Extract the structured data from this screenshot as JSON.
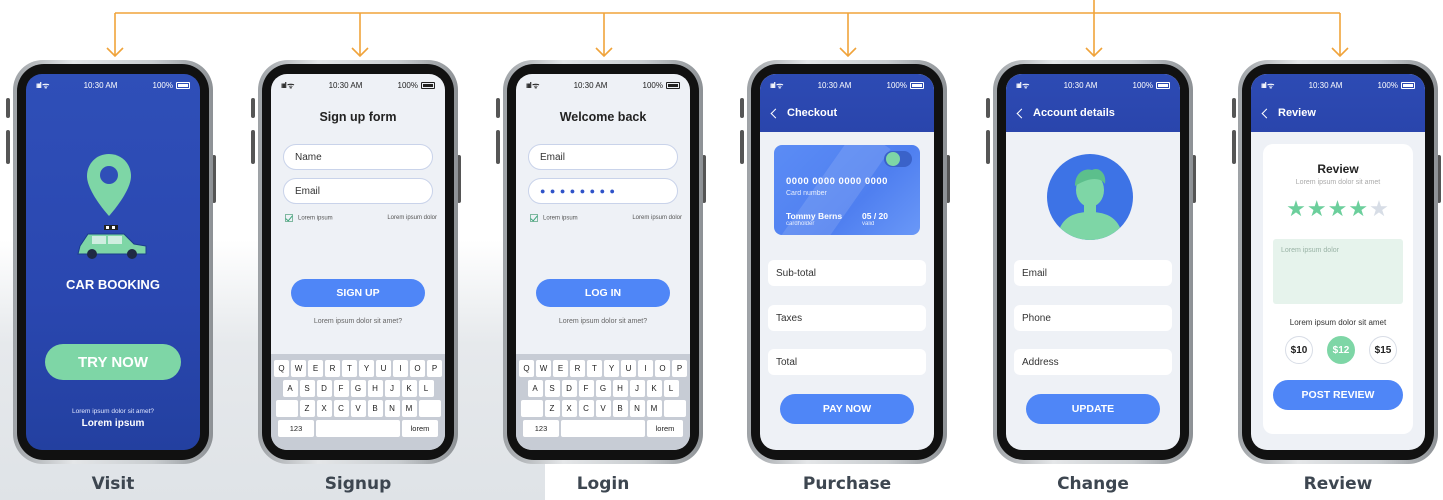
{
  "status_bar": {
    "signal": "ıııl ᯤ",
    "time": "10:30 AM",
    "battery": "100%"
  },
  "steps": [
    {
      "caption": "Visit"
    },
    {
      "caption": "Signup"
    },
    {
      "caption": "Login"
    },
    {
      "caption": "Purchase"
    },
    {
      "caption": "Change"
    },
    {
      "caption": "Review"
    }
  ],
  "visit": {
    "app_name": "CAR BOOKING",
    "try_button": "TRY NOW",
    "note": "Lorem ipsum dolor sit amet?",
    "link": "Lorem ipsum"
  },
  "signup": {
    "title": "Sign up form",
    "name_placeholder": "Name",
    "email_placeholder": "Email",
    "checkbox_label": "Lorem ipsum",
    "right_note": "Lorem ipsum dolor",
    "button": "SIGN UP",
    "note": "Lorem ipsum dolor sit amet?"
  },
  "login": {
    "title": "Welcome back",
    "email_placeholder": "Email",
    "password_mask": "● ● ● ● ● ● ● ●",
    "checkbox_label": "Lorem ipsum",
    "right_note": "Lorem ipsum dolor",
    "button": "LOG IN",
    "note": "Lorem ipsum dolor sit amet?"
  },
  "keyboard": {
    "row1": [
      "Q",
      "W",
      "E",
      "R",
      "T",
      "Y",
      "U",
      "I",
      "O",
      "P"
    ],
    "row2": [
      "A",
      "S",
      "D",
      "F",
      "G",
      "H",
      "J",
      "K",
      "L"
    ],
    "row3": [
      "",
      "Z",
      "X",
      "C",
      "V",
      "B",
      "N",
      "M",
      ""
    ],
    "numbers_key": "123",
    "lorem_key": "lorem"
  },
  "purchase": {
    "header": "Checkout",
    "card_number": "0000 0000 0000 0000",
    "card_number_label": "Card number",
    "holder_name": "Tommy Berns",
    "holder_label": "cardholder",
    "valid_value": "05 / 20",
    "valid_label": "valid",
    "rows": [
      "Sub-total",
      "Taxes",
      "Total"
    ],
    "button": "PAY NOW"
  },
  "change": {
    "header": "Account details",
    "rows": [
      "Email",
      "Phone",
      "Address"
    ],
    "button": "UPDATE"
  },
  "review": {
    "header": "Review",
    "card_title": "Review",
    "card_subtitle": "Lorem ipsum dolor sit amet",
    "rating": 4,
    "rating_max": 5,
    "textarea_placeholder": "Lorem ipsum dolor",
    "prompt": "Lorem ipsum dolor sit amet",
    "prices": [
      "$10",
      "$12",
      "$15"
    ],
    "selected_price": "$12",
    "button": "POST REVIEW"
  },
  "colors": {
    "flow_line": "#f0a33a",
    "primary_blue": "#4f86f7",
    "dark_blue": "#2b47af",
    "mint": "#7ed6a6"
  }
}
